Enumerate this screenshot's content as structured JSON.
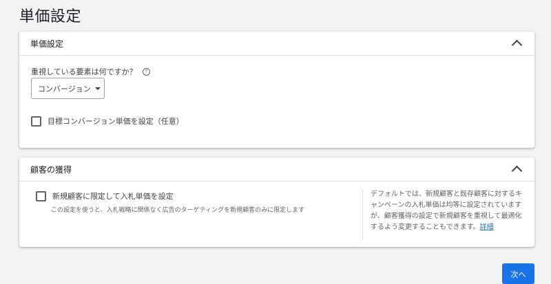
{
  "page": {
    "title": "単価設定"
  },
  "bid_section": {
    "title": "単価設定",
    "question": "重視している要素は何ですか？",
    "help_glyph": "?",
    "dropdown_value": "コンバージョン",
    "target_cpa_checkbox_label": "目標コンバージョン単価を設定（任意）",
    "target_cpa_checked": false
  },
  "customer_section": {
    "title": "顧客の獲得",
    "new_customer_checkbox_label": "新規顧客に限定して入札単価を設定",
    "new_customer_checked": false,
    "new_customer_description": "この設定を使うと、入札戦略に関係なく広告のターゲティングを新規顧客のみに限定します",
    "side_help_text": "デフォルトでは、新規顧客と既存顧客に対するキャンペーンの入札単価は均等に設定されていますが、顧客獲得の設定で新規顧客を重視して最適化するよう変更することもできます。",
    "side_help_link": "詳細"
  },
  "footer": {
    "next_label": "次へ"
  },
  "colors": {
    "primary": "#1a73e8",
    "background": "#f1f3f4"
  }
}
